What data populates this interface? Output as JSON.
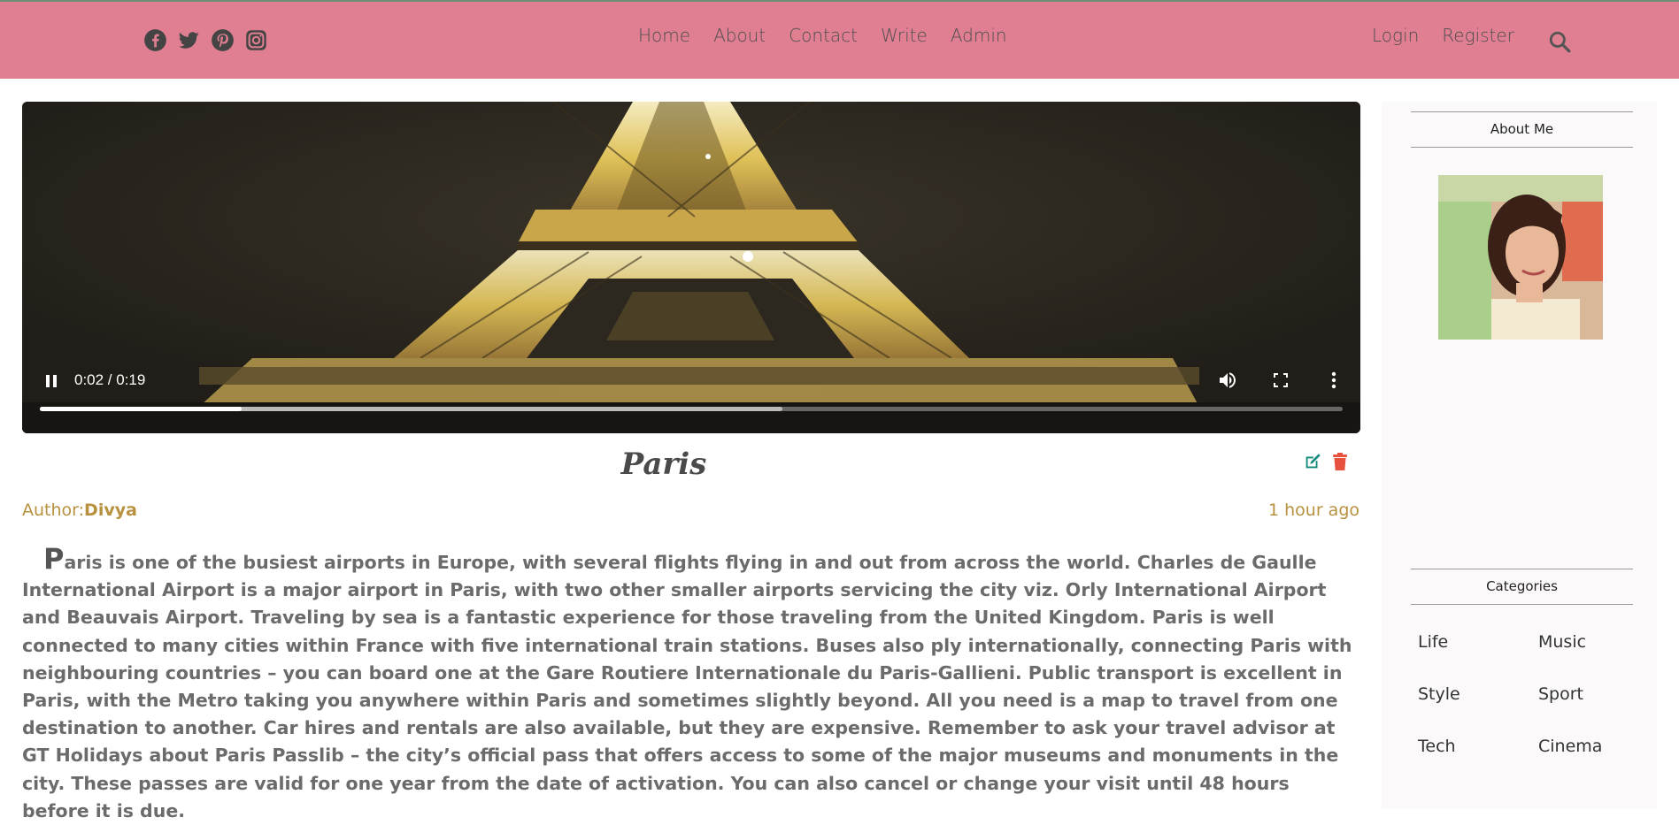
{
  "nav": {
    "social_icons": [
      "facebook-icon",
      "twitter-icon",
      "pinterest-icon",
      "instagram-icon"
    ],
    "center_links": [
      "Home",
      "About",
      "Contact",
      "Write",
      "Admin"
    ],
    "right_links": [
      "Login",
      "Register"
    ],
    "search_icon": "search-icon",
    "bar_color": "#e07f91"
  },
  "video": {
    "time_display": "0:02 / 0:19",
    "progress_fraction": 0.155,
    "buffered_fraction": 0.57
  },
  "post": {
    "title": "Paris",
    "author_label": "Author:",
    "author_name": "Divya",
    "posted": "1 hour ago",
    "drop_letter": "P",
    "body": "aris is one of the busiest airports in Europe, with several flights flying in and out from across the world. Charles de Gaulle International Airport is a major airport in Paris, with two other smaller airports servicing the city viz. Orly International Airport and Beauvais Airport. Traveling by sea is a fantastic experience for those traveling from the United Kingdom. Paris is well connected to many cities within France with five international train stations. Buses also ply internationally, connecting Paris with neighbouring countries – you can board one at the Gare Routiere Internationale du Paris-Gallieni. Public transport is excellent in Paris, with the Metro taking you anywhere within Paris and sometimes slightly beyond. All you need is a map to travel from one destination to another. Car hires and rentals are also available, but they are expensive. Remember to ask your travel advisor at GT Holidays about Paris Passlib – the city’s official pass that offers access to some of the major museums and monuments in the city. These passes are valid for one year from the date of activation. You can also cancel or change your visit until 48 hours before it is due.",
    "accent_color": "#b8913f"
  },
  "sidebar": {
    "about_title": "About Me",
    "categories_title": "Categories",
    "categories": [
      "Life",
      "Music",
      "Style",
      "Sport",
      "Tech",
      "Cinema"
    ]
  }
}
